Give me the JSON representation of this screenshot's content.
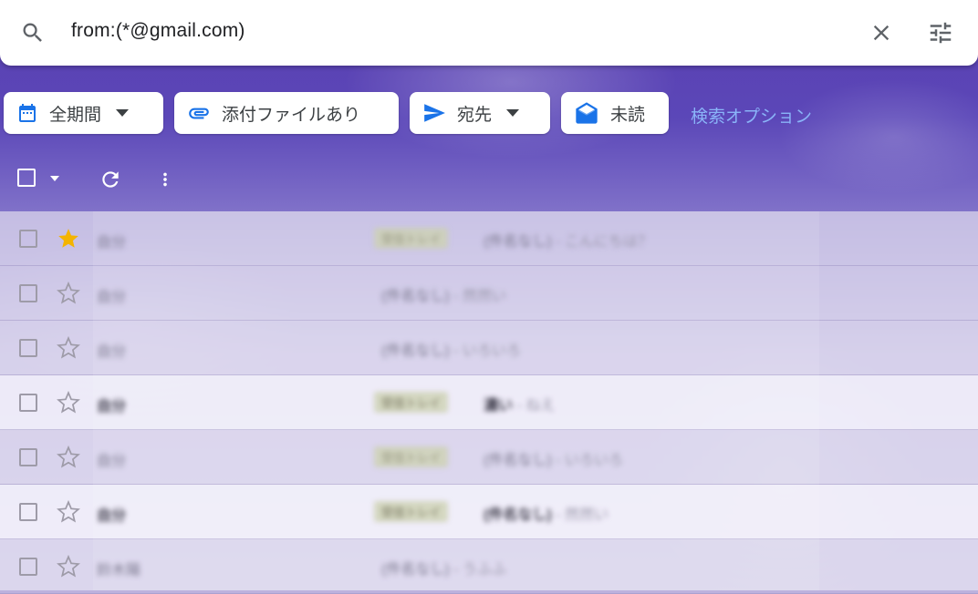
{
  "search": {
    "query": "from:(*@gmail.com)"
  },
  "chips": {
    "period": "全期間",
    "attachment": "添付ファイルあり",
    "to": "宛先",
    "unread": "未読"
  },
  "advanced_search_label": "検索オプション",
  "rows": [
    {
      "sender": "自分",
      "tag": "受信トレイ",
      "subject": "(件名なし)",
      "snippet": " - こんにちは？",
      "starred": true,
      "unread": false
    },
    {
      "sender": "自分",
      "tag": "",
      "subject": "(件名なし)",
      "snippet": " - 然然い",
      "starred": false,
      "unread": false
    },
    {
      "sender": "自分",
      "tag": "",
      "subject": "(件名なし)",
      "snippet": " - いろいろ",
      "starred": false,
      "unread": false
    },
    {
      "sender": "自分",
      "tag": "受信トレイ",
      "subject": "濃い",
      "snippet": " - ねえ",
      "starred": false,
      "unread": true
    },
    {
      "sender": "自分",
      "tag": "受信トレイ",
      "subject": "(件名なし)",
      "snippet": " - いろいろ",
      "starred": false,
      "unread": false
    },
    {
      "sender": "自分",
      "tag": "受信トレイ",
      "subject": "(件名なし)",
      "snippet": " - 然然い",
      "starred": false,
      "unread": true
    },
    {
      "sender": "鈴木陽",
      "tag": "",
      "subject": "(件名なし)",
      "snippet": " - うふふ",
      "starred": false,
      "unread": false
    }
  ],
  "colors": {
    "accent_blue": "#1a73e8",
    "star_gold": "#f4b400",
    "link": "#8ab4f8"
  }
}
